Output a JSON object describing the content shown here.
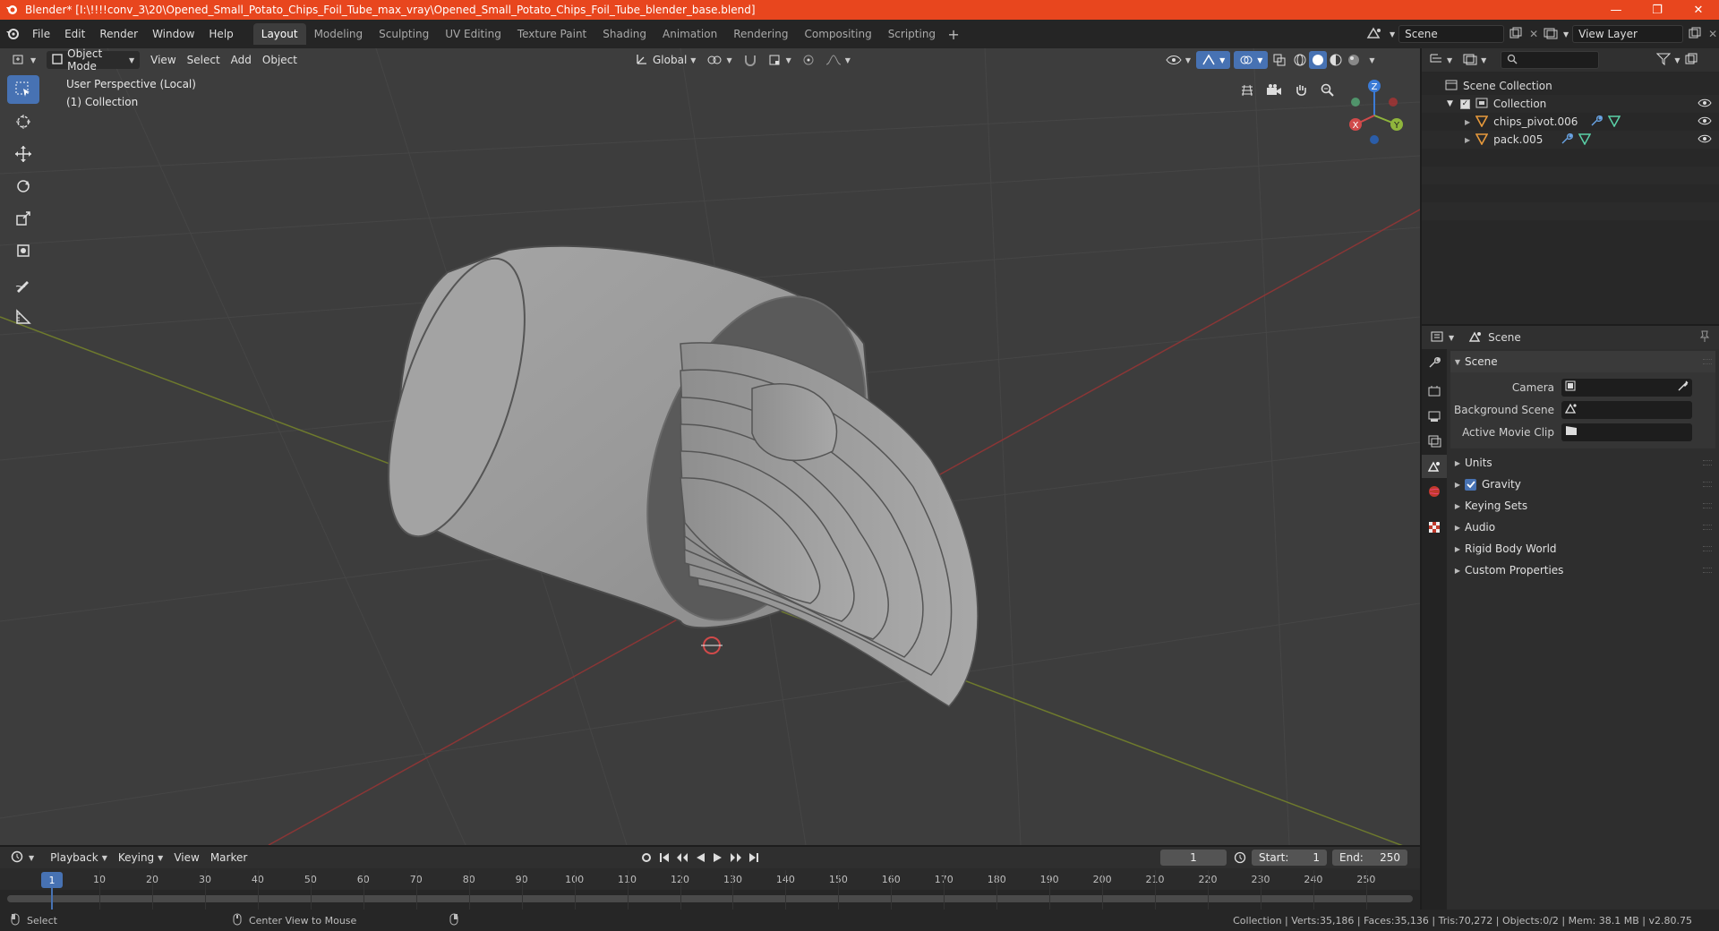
{
  "window": {
    "title": "Blender* [I:\\!!!!conv_3\\20\\Opened_Small_Potato_Chips_Foil_Tube_max_vray\\Opened_Small_Potato_Chips_Foil_Tube_blender_base.blend]",
    "min": "—",
    "max": "❐",
    "close": "✕"
  },
  "menu": [
    "File",
    "Edit",
    "Render",
    "Window",
    "Help"
  ],
  "workspaces": [
    "Layout",
    "Modeling",
    "Sculpting",
    "UV Editing",
    "Texture Paint",
    "Shading",
    "Animation",
    "Rendering",
    "Compositing",
    "Scripting"
  ],
  "workspace_plus": "+",
  "scene_name": "Scene",
  "view_layer": "View Layer",
  "viewport": {
    "mode": "Object Mode",
    "menus": [
      "View",
      "Select",
      "Add",
      "Object"
    ],
    "orientation": "Global",
    "info_line1": "User Perspective (Local)",
    "info_line2": "(1) Collection",
    "gizmo": {
      "x": "X",
      "y": "Y",
      "z": "Z"
    }
  },
  "outliner": {
    "root": "Scene Collection",
    "collection": "Collection",
    "items": [
      "chips_pivot.006",
      "pack.005"
    ]
  },
  "properties": {
    "context": "Scene",
    "section": "Scene",
    "rows": [
      {
        "label": "Camera"
      },
      {
        "label": "Background Scene"
      },
      {
        "label": "Active Movie Clip"
      }
    ],
    "panels": [
      "Units",
      "Gravity",
      "Keying Sets",
      "Audio",
      "Rigid Body World",
      "Custom Properties"
    ]
  },
  "timeline": {
    "menus": [
      "Playback",
      "Keying",
      "View",
      "Marker"
    ],
    "current_frame": "1",
    "start_label": "Start:",
    "start": "1",
    "end_label": "End:",
    "end": "250",
    "ticks": [
      "10",
      "20",
      "30",
      "40",
      "50",
      "60",
      "70",
      "80",
      "90",
      "100",
      "110",
      "120",
      "130",
      "140",
      "150",
      "160",
      "170",
      "180",
      "190",
      "200",
      "210",
      "220",
      "230",
      "240",
      "250"
    ],
    "playhead_label": "1"
  },
  "status": {
    "left": "Select",
    "middle": "Center View to Mouse",
    "right": "Collection | Verts:35,186 | Faces:35,136 | Tris:70,272 | Objects:0/2 | Mem: 38.1 MB | v2.80.75"
  },
  "colors": {
    "titlebar": "#e8461e",
    "accent": "#4772b3",
    "viewport_bg": "#3d3d3d",
    "axis_x": "#d04a4a",
    "axis_y": "#8fb53c",
    "axis_z": "#3b7bd6"
  }
}
